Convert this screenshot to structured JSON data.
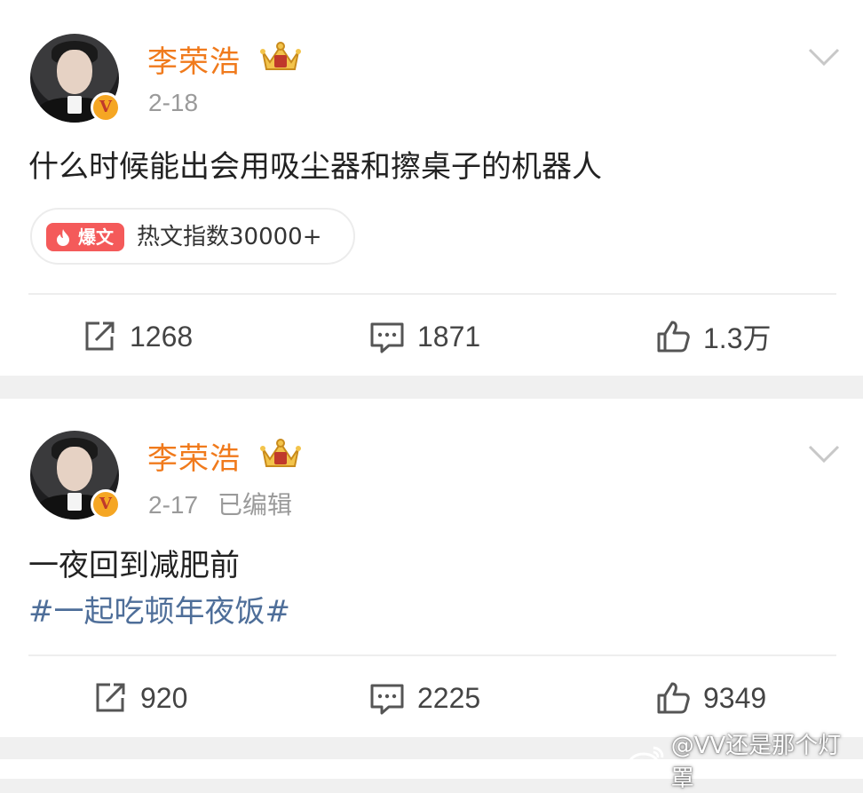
{
  "posts": [
    {
      "username": "李荣浩",
      "date": "2-18",
      "edited": "",
      "text": "什么时候能出会用吸尘器和擦桌子的机器人",
      "hashtag": "",
      "hot_badge": "爆文",
      "hot_text": "热文指数30000+",
      "reposts": "1268",
      "comments": "1871",
      "likes": "1.3万"
    },
    {
      "username": "李荣浩",
      "date": "2-17",
      "edited": "已编辑",
      "text": "一夜回到减肥前",
      "hashtag": "#一起吃顿年夜饭#",
      "reposts": "920",
      "comments": "2225",
      "likes": "9349"
    }
  ],
  "watermark": "@VV还是那个灯罩",
  "colors": {
    "username": "#f07a1c",
    "hashtag": "#4e6e99",
    "hot_badge": "#f45a5a",
    "verified": "#f5a623"
  },
  "icons": [
    "verified-badge-icon",
    "crown-icon",
    "chevron-down-icon",
    "fire-icon",
    "repost-icon",
    "comment-icon",
    "like-icon",
    "weibo-logo-icon"
  ]
}
